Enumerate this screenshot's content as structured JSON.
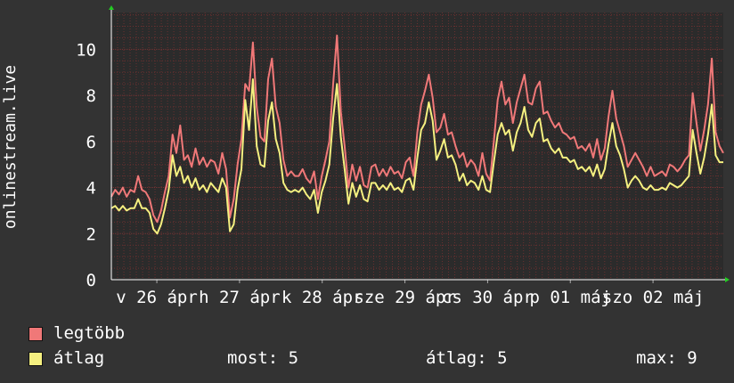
{
  "chart_data": {
    "type": "line",
    "ylabel": "onlinestream.live",
    "ylim": [
      0,
      11.6
    ],
    "yticks": [
      0,
      2,
      4,
      6,
      8,
      10
    ],
    "grid": true,
    "x_tick_labels": [
      "v 26 ápr",
      "h 27 ápr",
      "k 28 ápr",
      "sze 29 ápr",
      "cs 30 ápr",
      "p 01 máj",
      "szo 02 máj"
    ],
    "background_color": "#2b2b2b",
    "grid_color": "#6a3030",
    "series": [
      {
        "name": "legtöbb",
        "color": "#f07878",
        "values": [
          3.6,
          3.9,
          3.7,
          4.0,
          3.6,
          3.9,
          3.8,
          4.5,
          3.9,
          3.8,
          3.5,
          2.8,
          2.5,
          3.0,
          3.8,
          4.5,
          6.3,
          5.5,
          6.7,
          5.2,
          5.4,
          4.9,
          5.7,
          5.0,
          5.3,
          4.9,
          5.2,
          5.1,
          4.6,
          5.5,
          4.8,
          2.7,
          3.5,
          5.0,
          6.1,
          8.5,
          8.2,
          10.3,
          7.5,
          6.2,
          6.0,
          8.7,
          9.6,
          7.5,
          6.8,
          5.2,
          4.5,
          4.7,
          4.5,
          4.5,
          4.8,
          4.4,
          4.2,
          4.7,
          3.5,
          4.5,
          5.2,
          6.0,
          8.5,
          10.6,
          7.3,
          5.8,
          4.0,
          5.0,
          4.3,
          4.9,
          4.1,
          4.0,
          4.9,
          5.0,
          4.5,
          4.8,
          4.5,
          4.9,
          4.6,
          4.7,
          4.4,
          5.1,
          5.3,
          4.5,
          6.4,
          7.6,
          8.2,
          8.9,
          7.9,
          6.4,
          6.6,
          7.2,
          6.3,
          6.4,
          5.8,
          5.3,
          5.5,
          4.9,
          5.2,
          5.0,
          4.5,
          5.5,
          4.6,
          4.3,
          6.0,
          7.8,
          8.6,
          7.6,
          7.9,
          6.8,
          7.7,
          8.3,
          8.9,
          7.7,
          7.6,
          8.3,
          8.6,
          7.2,
          7.3,
          6.9,
          6.6,
          6.8,
          6.4,
          6.3,
          6.1,
          6.2,
          5.7,
          5.8,
          5.6,
          5.9,
          5.3,
          6.1,
          5.2,
          5.7,
          7.1,
          8.2,
          7.0,
          6.4,
          5.8,
          4.9,
          5.2,
          5.5,
          5.2,
          4.9,
          4.5,
          4.9,
          4.5,
          4.6,
          4.7,
          4.5,
          5.0,
          4.9,
          4.7,
          4.9,
          5.2,
          5.4,
          8.1,
          6.8,
          5.6,
          6.5,
          7.6,
          9.6,
          6.4,
          5.8,
          5.5
        ]
      },
      {
        "name": "átlag",
        "color": "#f5f080",
        "values": [
          3.1,
          3.2,
          3.0,
          3.2,
          3.0,
          3.1,
          3.1,
          3.5,
          3.1,
          3.1,
          2.9,
          2.2,
          2.0,
          2.4,
          3.1,
          3.9,
          5.4,
          4.5,
          4.9,
          4.2,
          4.5,
          4.0,
          4.4,
          3.9,
          4.1,
          3.8,
          4.2,
          4.0,
          3.8,
          4.4,
          4.0,
          2.1,
          2.4,
          3.9,
          4.8,
          7.8,
          6.5,
          8.7,
          5.8,
          5.0,
          4.9,
          6.9,
          7.7,
          6.1,
          5.5,
          4.2,
          3.9,
          3.8,
          3.9,
          3.8,
          4.0,
          3.7,
          3.5,
          3.9,
          2.9,
          3.8,
          4.3,
          5.0,
          7.0,
          8.5,
          6.2,
          4.8,
          3.3,
          4.2,
          3.6,
          4.1,
          3.5,
          3.4,
          4.2,
          4.2,
          3.9,
          4.1,
          3.9,
          4.2,
          3.9,
          4.0,
          3.8,
          4.3,
          4.4,
          3.9,
          5.3,
          6.5,
          6.8,
          7.7,
          6.9,
          5.2,
          5.6,
          6.1,
          5.3,
          5.4,
          5.0,
          4.3,
          4.6,
          4.1,
          4.3,
          4.2,
          3.9,
          4.5,
          3.9,
          3.8,
          5.1,
          6.3,
          6.8,
          6.3,
          6.5,
          5.6,
          6.4,
          6.8,
          7.5,
          6.5,
          6.2,
          6.8,
          7.0,
          6.0,
          6.1,
          5.7,
          5.5,
          5.7,
          5.3,
          5.3,
          5.1,
          5.2,
          4.8,
          4.9,
          4.7,
          4.9,
          4.5,
          5.0,
          4.4,
          4.8,
          5.9,
          6.8,
          5.8,
          5.4,
          4.8,
          4.0,
          4.3,
          4.5,
          4.3,
          4.0,
          3.9,
          4.1,
          3.9,
          3.9,
          4.0,
          3.9,
          4.2,
          4.1,
          4.0,
          4.1,
          4.3,
          4.5,
          6.5,
          5.5,
          4.6,
          5.3,
          6.3,
          7.6,
          5.4,
          5.1,
          5.1
        ]
      }
    ]
  },
  "legend": {
    "max_label": "legtöbb",
    "avg_label": "átlag",
    "stats": {
      "current": "most: 5",
      "average": "átlag: 5",
      "maximum": "max: 9"
    }
  }
}
